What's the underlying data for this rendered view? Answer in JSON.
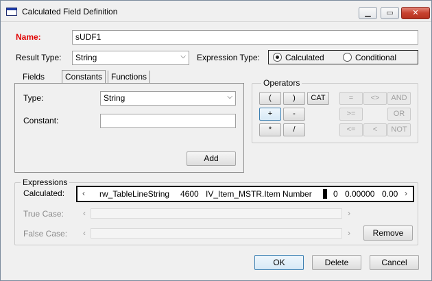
{
  "window": {
    "title": "Calculated Field Definition"
  },
  "name": {
    "label": "Name:",
    "value": "sUDF1"
  },
  "result_type": {
    "label": "Result Type:",
    "value": "String"
  },
  "expression_type": {
    "label": "Expression Type:",
    "options": [
      "Calculated",
      "Conditional"
    ],
    "selected": "Calculated"
  },
  "tabs": [
    {
      "label": "Fields"
    },
    {
      "label": "Constants"
    },
    {
      "label": "Functions"
    }
  ],
  "constants_panel": {
    "type_label": "Type:",
    "type_value": "String",
    "constant_label": "Constant:",
    "constant_value": "",
    "add_label": "Add"
  },
  "operators": {
    "title": "Operators",
    "buttons": [
      "(",
      ")",
      "CAT",
      "=",
      "<>",
      "AND",
      "+",
      "-",
      ">=",
      "OR",
      "*",
      "/",
      "<=",
      "<",
      "NOT"
    ]
  },
  "expressions": {
    "title": "Expressions",
    "calculated_label": "Calculated:",
    "calculated_parts": [
      "rw_TableLineString",
      "4600",
      "IV_Item_MSTR.Item Number",
      "0",
      "0.00000",
      "0.00"
    ],
    "true_case_label": "True Case:",
    "false_case_label": "False Case:",
    "remove_label": "Remove"
  },
  "footer": {
    "ok_label": "OK",
    "delete_label": "Delete",
    "cancel_label": "Cancel"
  }
}
